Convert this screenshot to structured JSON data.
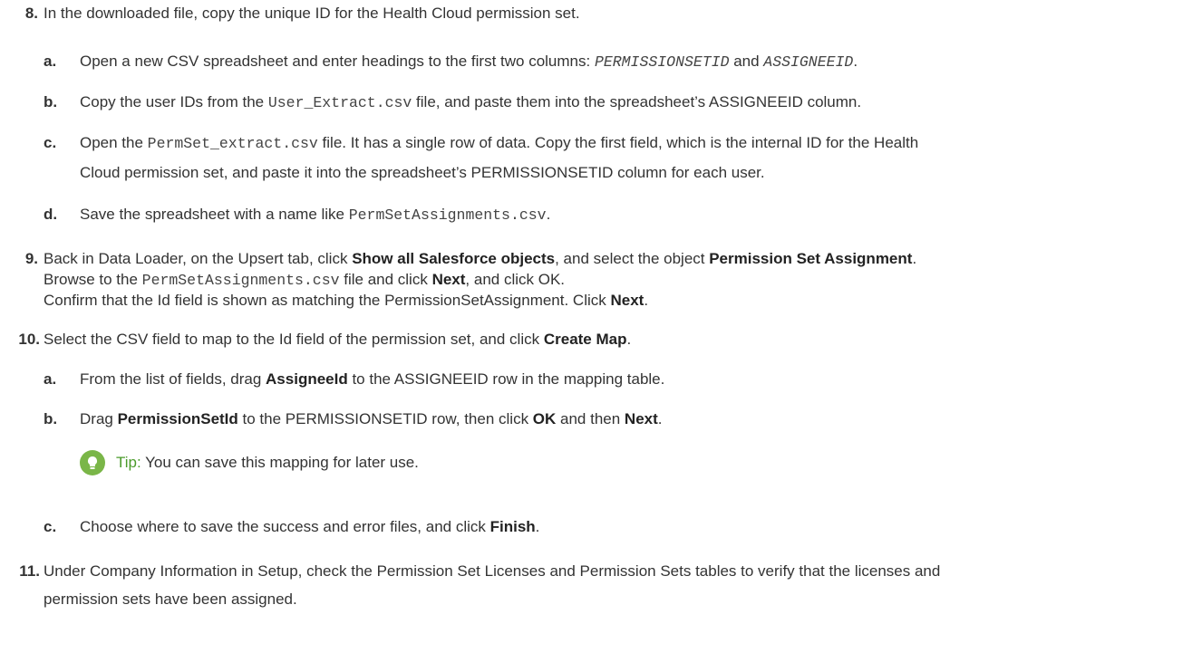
{
  "step8": {
    "number": "8.",
    "text": "In the downloaded file, copy the unique ID for the Health Cloud permission set.",
    "a": {
      "letter": "a.",
      "t1": "Open a new CSV spreadsheet and enter headings to the first two columns: ",
      "code1": "PERMISSIONSETID",
      "t2": " and ",
      "code2": "ASSIGNEEID",
      "t3": "."
    },
    "b": {
      "letter": "b.",
      "t1": "Copy the user IDs from the ",
      "code1": "User_Extract.csv",
      "t2": " file, and paste them into the spreadsheet’s ASSIGNEEID column."
    },
    "c": {
      "letter": "c.",
      "t1": "Open the ",
      "code1": "PermSet_extract.csv",
      "t2": " file. It has a single row of data. Copy the first field, which is the internal ID for the Health",
      "line2": "Cloud permission set, and paste it into the spreadsheet’s PERMISSIONSETID column for each user."
    },
    "d": {
      "letter": "d.",
      "t1": "Save the spreadsheet with a name like ",
      "code1": "PermSetAssignments.csv",
      "t2": "."
    }
  },
  "step9": {
    "number": "9.",
    "l1_t1": "Back in Data Loader, on the Upsert tab, click ",
    "l1_b1": "Show all Salesforce objects",
    "l1_t2": ", and select the object ",
    "l1_b2": "Permission Set Assignment",
    "l1_t3": ".",
    "l2_t1": "Browse to the ",
    "l2_code": "PermSetAssignments.csv",
    "l2_t2": " file and click ",
    "l2_b1": "Next",
    "l2_t3": ", and click OK.",
    "l3_t1": "Confirm that the Id field is shown as matching the PermissionSetAssignment. Click ",
    "l3_b1": "Next",
    "l3_t2": "."
  },
  "step10": {
    "number": "10.",
    "t1": "Select the CSV field to map to the Id field of the permission set, and click ",
    "b1": "Create Map",
    "t2": ".",
    "a": {
      "letter": "a.",
      "t1": "From the list of fields, drag ",
      "b1": "AssigneeId",
      "t2": " to the ASSIGNEEID row in the mapping table."
    },
    "b": {
      "letter": "b.",
      "t1": "Drag ",
      "b1": "PermissionSetId",
      "t2": " to the PERMISSIONSETID row, then click ",
      "b2": "OK",
      "t3": " and then ",
      "b3": "Next",
      "t4": "."
    },
    "tip": {
      "label": "Tip:",
      "text": " You can save this mapping for later use."
    },
    "c": {
      "letter": "c.",
      "t1": "Choose where to save the success and error files, and click ",
      "b1": "Finish",
      "t2": "."
    }
  },
  "step11": {
    "number": "11.",
    "line1": "Under Company Information in Setup, check the Permission Set Licenses and Permission Sets tables to verify that the licenses and",
    "line2": "permission sets have been assigned."
  }
}
